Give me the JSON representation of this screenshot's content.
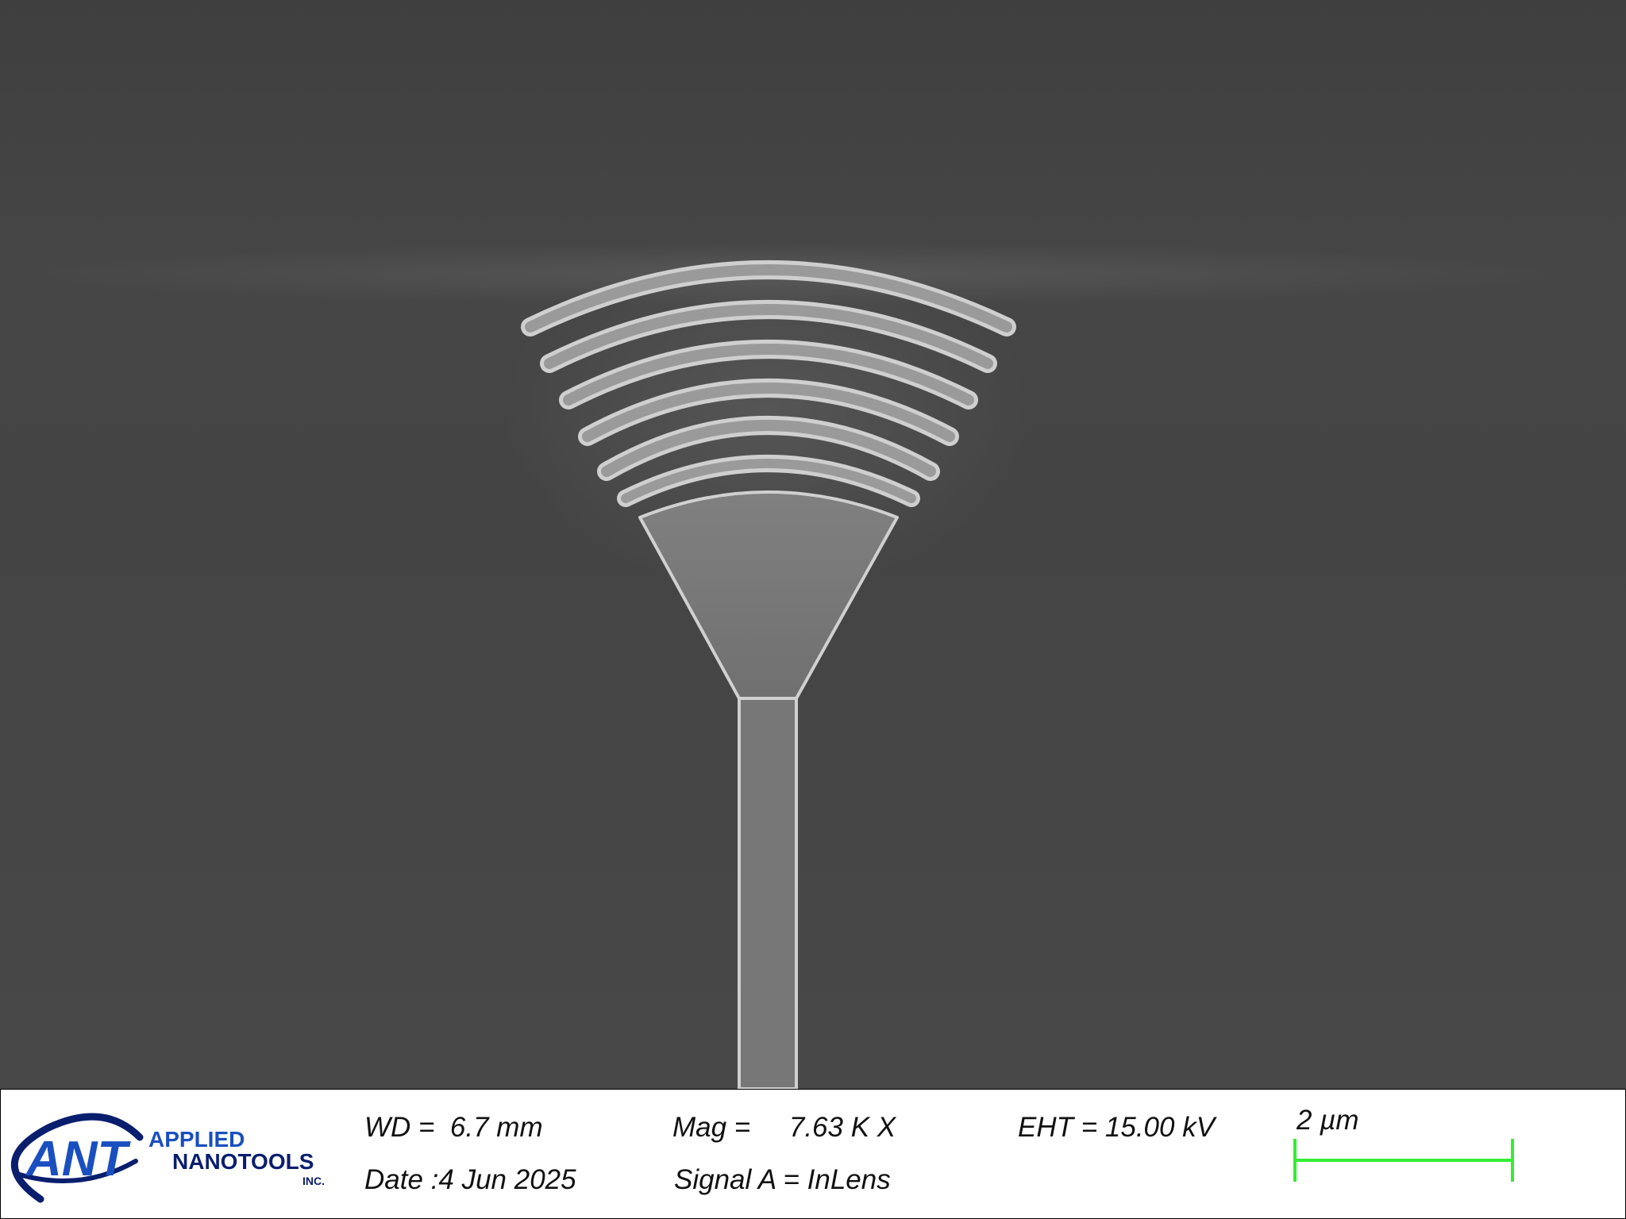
{
  "colors": {
    "background": "#3e3e3e",
    "structure": "#7a7a7a",
    "edge_highlight": "#d2d2d2",
    "databar": "#ffffff",
    "scale_bar": "#33ee33",
    "logo_blue": "#1a4fc0",
    "logo_navy": "#0a1e6e"
  },
  "image": {
    "description_icon": "grating-coupler-icon"
  },
  "logo": {
    "mark": "ANT",
    "line1": "APPLIED",
    "line2": "NANOTOOLS",
    "line3": "INC."
  },
  "info": {
    "wd": "WD =  6.7 mm",
    "date": "Date :4 Jun 2025",
    "mag": "Mag =     7.63 K X",
    "signal": "Signal A = InLens",
    "eht": "EHT = 15.00 kV"
  },
  "scale": {
    "label": "2 µm"
  }
}
